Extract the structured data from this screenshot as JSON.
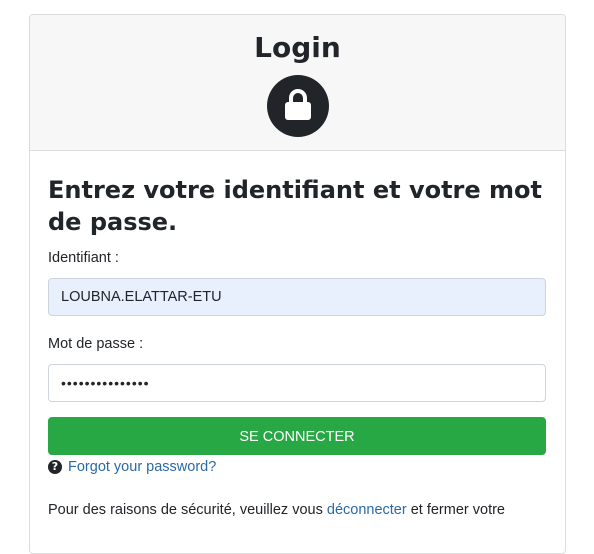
{
  "header": {
    "title": "Login",
    "icon": "lock-icon"
  },
  "form": {
    "prompt": "Entrez votre identifiant et votre mot de passe.",
    "username_label": "Identifiant :",
    "username_value": "LOUBNA.ELATTAR-ETU",
    "password_label": "Mot de passe :",
    "password_value": "•••••••••••••••",
    "submit_label": "SE CONNECTER",
    "forgot_icon": "question-circle-icon",
    "forgot_label": "Forgot your password?"
  },
  "notice": {
    "text_before": "Pour des raisons de sécurité, veuillez vous ",
    "link": "déconnecter",
    "text_after": " et fermer votre"
  },
  "colors": {
    "primary_button": "#28a745",
    "link": "#2b6aa6",
    "autofill_bg": "#e8f0fe",
    "header_bg": "#f7f7f7"
  }
}
